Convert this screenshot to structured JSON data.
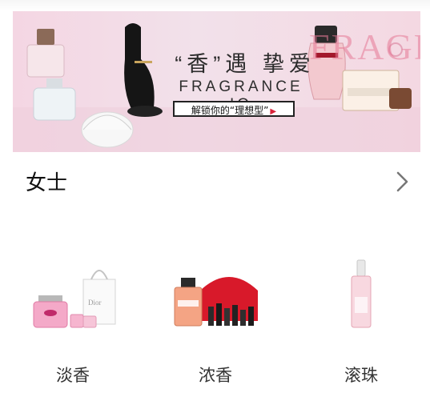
{
  "banner": {
    "title": "“香”遇 挚爱",
    "subtitle": "FRAGRANCE IQ",
    "cta": "解锁你的“理想型”",
    "deco_text": "FRAGR",
    "colors": {
      "background": "#f3dbe5",
      "accent": "#d9243b"
    }
  },
  "section": {
    "title": "女士",
    "more_icon": "chevron-right-icon"
  },
  "categories": [
    {
      "label": "淡香"
    },
    {
      "label": "浓香"
    },
    {
      "label": "滚珠"
    }
  ]
}
